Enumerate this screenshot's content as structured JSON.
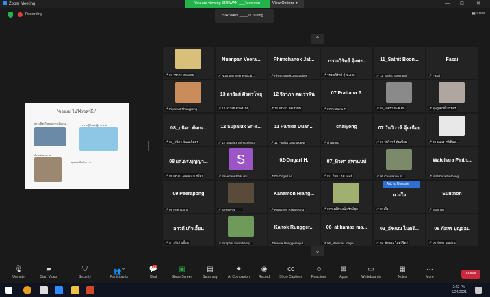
{
  "window": {
    "title": "Zoom Meeting",
    "viewing_banner": "You are viewing SIRIWAN ___'s screen",
    "view_options": "View Options",
    "controls": [
      "—",
      "⊡",
      "✕"
    ]
  },
  "infobar": {
    "recording": "Recording",
    "talking": "SIRIWAN ____ is talking...",
    "view_label": "View"
  },
  "shared_screen": {
    "heading": "\"ของแม่ ไม่ใช้เวลาถึง\"",
    "caption1": "สถานที่ชมวิวตลอดการเดินทาง...",
    "caption2": "ความรู้สึกของผู้จำหน่าย",
    "caption3": "ทัศนะต่อสุขภาพ",
    "caption4": "คุณสมบัติหลักการ..."
  },
  "tiles": [
    {
      "name": "",
      "label": "07 วรากร ทองแสน",
      "img": "#d9c07a",
      "avatar": ""
    },
    {
      "name": "Nuanpan Veera...",
      "label": "Nuanpan Veeravedcai...",
      "img": "",
      "avatar": ""
    },
    {
      "name": "Phimchanok Jat...",
      "label": "Phimchanok Jaturapitee",
      "img": "",
      "avatar": ""
    },
    {
      "name": "วรรณวิรัทย์ คุ้งพะ...",
      "label": "วรรณวิรัทย์ คุ้งพะเวธ",
      "img": "",
      "avatar": ""
    },
    {
      "name": "11_Sathit Boon...",
      "label": "11_Sathit Boonrami",
      "img": "",
      "avatar": ""
    },
    {
      "name": "Fasai",
      "label": "Fasai",
      "img": "",
      "avatar": ""
    },
    {
      "name": "",
      "label": "Piyachat Thongpeng",
      "img": "#c98c5a",
      "avatar": ""
    },
    {
      "name": "13 ลาวัลย์ ศิวพรโพธุ",
      "label": "13 ลาวัลย์ ศิวพรโพธุ",
      "img": "",
      "avatar": ""
    },
    {
      "name": "12 จิราภา ตดเราพิน",
      "label": "12 จิราภา ตดเราพิน",
      "img": "",
      "avatar": ""
    },
    {
      "name": "07 Prattana P.",
      "label": "07 Prattana P.",
      "img": "",
      "avatar": ""
    },
    {
      "name": "",
      "label": "07_เกศรา ทะพีเศษ",
      "img": "#8a8a8a",
      "avatar": ""
    },
    {
      "name": "",
      "label": "ดุษฎี ศักดิ์บารมีศรี",
      "img": "#b0a6a0",
      "avatar": ""
    },
    {
      "name": "08_ปนิดา พัฒน...",
      "label": "08_ปนิดา พัฒนเกิดตร",
      "img": "",
      "avatar": ""
    },
    {
      "name": "12 Supalux Sri-s...",
      "label": "12 Supalux Sri-somlong",
      "img": "",
      "avatar": ""
    },
    {
      "name": "11 Panida Duan...",
      "label": "11 Panida Duangkaew",
      "img": "",
      "avatar": ""
    },
    {
      "name": "chaiyong",
      "label": "chaiyong",
      "img": "",
      "avatar": ""
    },
    {
      "name": "07 วันวิวาห์ คุ้มเนื่อย",
      "label": "07 วันวิวาห์ คุ้มเนื่อย",
      "img": "",
      "avatar": ""
    },
    {
      "name": "",
      "label": "30 ธนพร ศรีเดิมล...",
      "img": "#e8e8e8",
      "avatar": ""
    },
    {
      "name": "08 ผศ.ดร.บุญญา...",
      "label": "08 ผศ.ดร.บุญญาภา ศรีสุข",
      "img": "",
      "avatar": ""
    },
    {
      "name": "",
      "label": "Savettara Phikulsri",
      "img": "",
      "avatar": "S"
    },
    {
      "name": "02-Ongart H.",
      "label": "02-Ongart H.",
      "img": "",
      "avatar": ""
    },
    {
      "name": "07_ทิวทา สุทานนท์",
      "label": "07_ทิวทา สุทานนท์",
      "img": "",
      "avatar": ""
    },
    {
      "name": "",
      "label": "06 Chaiyapon S...",
      "img": "#7a8a6a",
      "avatar": ""
    },
    {
      "name": "Watchara Pinth...",
      "label": "Watchara Pinthong",
      "img": "",
      "avatar": ""
    },
    {
      "name": "09 Peerapong",
      "label": "09 Peerapong",
      "img": "",
      "avatar": ""
    },
    {
      "name": "",
      "label": "SIRIWAN ____",
      "img": "#5a4a3a",
      "avatar": ""
    },
    {
      "name": "Kanamon Riang...",
      "label": "Kanamon Riangwong",
      "img": "",
      "avatar": ""
    },
    {
      "name": "",
      "label": "07 พงษ์ลักษณ์ สุรักษ์ชุด",
      "img": "#a0b070",
      "avatar": ""
    },
    {
      "name": "ดวงใจ",
      "label": "ดวงใจ",
      "img": "",
      "avatar": ""
    },
    {
      "name": "Sunthon",
      "label": "Sunthon",
      "img": "",
      "avatar": ""
    },
    {
      "name": "ลาวดี เก้าเอี้ยน",
      "label": "ลาวดี เก้าเอี้ยน",
      "img": "",
      "avatar": ""
    },
    {
      "name": "",
      "label": "Siraphat Surinthamp...",
      "img": "#6e9a5a",
      "avatar": ""
    },
    {
      "name": "Kanok Rungger...",
      "label": "Kanok Runggeratigul",
      "img": "",
      "avatar": ""
    },
    {
      "name": "06_atikamas ma...",
      "label": "06_atikamas maijui",
      "img": "",
      "avatar": ""
    },
    {
      "name": "02_อัฑแณ ไมตรี...",
      "label": "02_อัฑแณ ไมตรีจิตร์",
      "img": "",
      "avatar": ""
    },
    {
      "name": "06 ภัสสร บุญอ่อน",
      "label": "06 ภัสสร บุญอ่อน",
      "img": "",
      "avatar": ""
    }
  ],
  "ask_to_unmute": "Ask to Unmute",
  "toolbar": {
    "unmute": "Unmute",
    "start_video": "Start Video",
    "security": "Security",
    "participants": "Participants",
    "participants_count": "78",
    "chat": "Chat",
    "chat_badge": "16",
    "share_screen": "Share Screen",
    "summary": "Summary",
    "ai_companion": "AI Companion",
    "record": "Record",
    "show_captions": "Show Captions",
    "reactions": "Reactions",
    "apps": "Apps",
    "whiteboards": "Whiteboards",
    "notes": "Notes",
    "more": "More",
    "leave": "Leave"
  },
  "taskbar": {
    "time": "2:22 PM",
    "date": "6/24/2021"
  },
  "colors": {
    "green": "#24b34b",
    "leave": "#c8293c",
    "avatar_purple": "#9b55c7"
  }
}
